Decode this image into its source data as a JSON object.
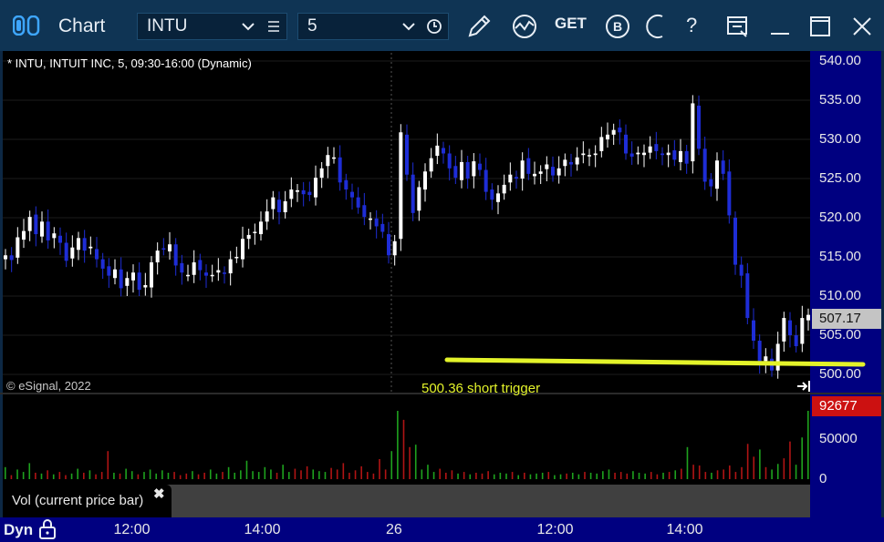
{
  "window": {
    "title": "Chart",
    "symbol": "INTU",
    "interval": "5"
  },
  "toolbar_icons": [
    "pencil-icon",
    "study-icon",
    "get-icon",
    "b-icon",
    "moon-icon",
    "help-icon",
    "layout-icon",
    "minimize-icon",
    "maximize-icon",
    "close-icon"
  ],
  "toolbar_labels": {
    "get": "GET",
    "b": "B",
    "help": "?"
  },
  "chart": {
    "header": "* INTU, INTUIT INC, 5, 09:30-16:00 (Dynamic)",
    "copyright": "© eSignal, 2022",
    "trigger_label": "500.36 short trigger",
    "last_price_tag": "507.17",
    "volume_tag": "92677",
    "volume_legend": "Vol (current price bar)",
    "volume_close": "✖",
    "footer_mode": "Dyn"
  },
  "colors": {
    "up_candle": "#ffffff",
    "down_candle": "#1e2dd6",
    "trigger_line": "#e3f32a",
    "volume_up": "#1ea21e",
    "volume_down": "#b01414",
    "axis_bg": "#000080"
  },
  "chart_data": {
    "type": "candlestick",
    "title": "INTU, INTUIT INC, 5, 09:30-16:00 (Dynamic)",
    "ylim": [
      498,
      541
    ],
    "y_ticks": [
      "540.00",
      "535.00",
      "530.00",
      "525.00",
      "520.00",
      "515.00",
      "510.00",
      "505.00",
      "500.00"
    ],
    "x_ticks": [
      "12:00",
      "14:00",
      "26",
      "12:00",
      "14:00"
    ],
    "close": [
      515.2,
      514.6,
      517.5,
      518.3,
      520.1,
      517.9,
      519.5,
      517.1,
      518.0,
      516.8,
      514.5,
      516.2,
      517.4,
      515.8,
      516.3,
      514.7,
      513.5,
      512.6,
      513.4,
      511.0,
      512.3,
      513.0,
      510.8,
      511.4,
      514.3,
      515.8,
      516.0,
      516.6,
      513.9,
      513.0,
      512.7,
      514.3,
      513.3,
      512.6,
      512.7,
      513.3,
      512.9,
      514.7,
      515.0,
      517.3,
      517.8,
      518.2,
      519.5,
      520.8,
      522.6,
      520.7,
      522.1,
      523.6,
      523.5,
      523.0,
      522.9,
      525.1,
      526.3,
      528.0,
      527.7,
      524.5,
      523.6,
      522.6,
      521.3,
      520.1,
      519.9,
      518.9,
      518.2,
      515.2,
      517.0,
      530.9,
      525.5,
      520.6,
      523.9,
      525.9,
      527.6,
      529.2,
      528.2,
      526.3,
      525.1,
      527.1,
      525.0,
      527.2,
      526.1,
      523.3,
      522.3,
      523.1,
      524.2,
      525.5,
      525.0,
      527.3,
      525.6,
      525.6,
      525.9,
      526.8,
      525.4,
      526.3,
      527.4,
      526.8,
      527.7,
      528.2,
      528.0,
      528.2,
      530.3,
      530.6,
      531.2,
      530.9,
      528.2,
      527.8,
      528.3,
      528.3,
      529.1,
      528.5,
      528.0,
      528.3,
      527.4,
      528.5,
      526.9,
      534.6,
      528.8,
      524.6,
      524.0,
      527.3,
      525.6,
      520.3,
      514.0,
      512.6,
      507.2,
      504.3,
      501.4,
      502.3,
      500.5,
      503.9,
      507.2,
      505.0,
      503.6,
      507.2,
      507.6
    ],
    "volume": [
      15000,
      5000,
      12000,
      9000,
      20000,
      8000,
      7000,
      11000,
      6000,
      9000,
      5000,
      7000,
      13000,
      8000,
      11000,
      6000,
      9000,
      35000,
      8000,
      7000,
      13000,
      10000,
      6000,
      9000,
      12000,
      7000,
      11000,
      8000,
      9000,
      5000,
      7000,
      10000,
      6000,
      8000,
      12000,
      7000,
      9000,
      15000,
      8000,
      11000,
      23000,
      10000,
      9000,
      15000,
      12000,
      8000,
      18000,
      9000,
      13000,
      11000,
      16000,
      12000,
      10000,
      9000,
      14000,
      12000,
      20000,
      8000,
      11000,
      16000,
      9000,
      7000,
      25000,
      12000,
      35000,
      92000,
      74000,
      40000,
      43000,
      12000,
      18000,
      9000,
      13000,
      8000,
      11000,
      7000,
      9000,
      6000,
      8000,
      7000,
      10000,
      6000,
      8000,
      7000,
      9000,
      5000,
      8000,
      6000,
      7000,
      8000,
      9000,
      5000,
      6000,
      7000,
      8000,
      6000,
      9000,
      8000,
      7000,
      10000,
      12000,
      8000,
      9000,
      7000,
      10000,
      8000,
      7000,
      9000,
      6000,
      8000,
      9000,
      11000,
      13000,
      40000,
      18000,
      17000,
      9000,
      8000,
      11000,
      12000,
      17000,
      9000,
      15000,
      44000,
      28000,
      37000,
      15000,
      12000,
      19000,
      26000,
      47000,
      18000,
      52000,
      92677
    ],
    "trigger_level": 500.36
  }
}
